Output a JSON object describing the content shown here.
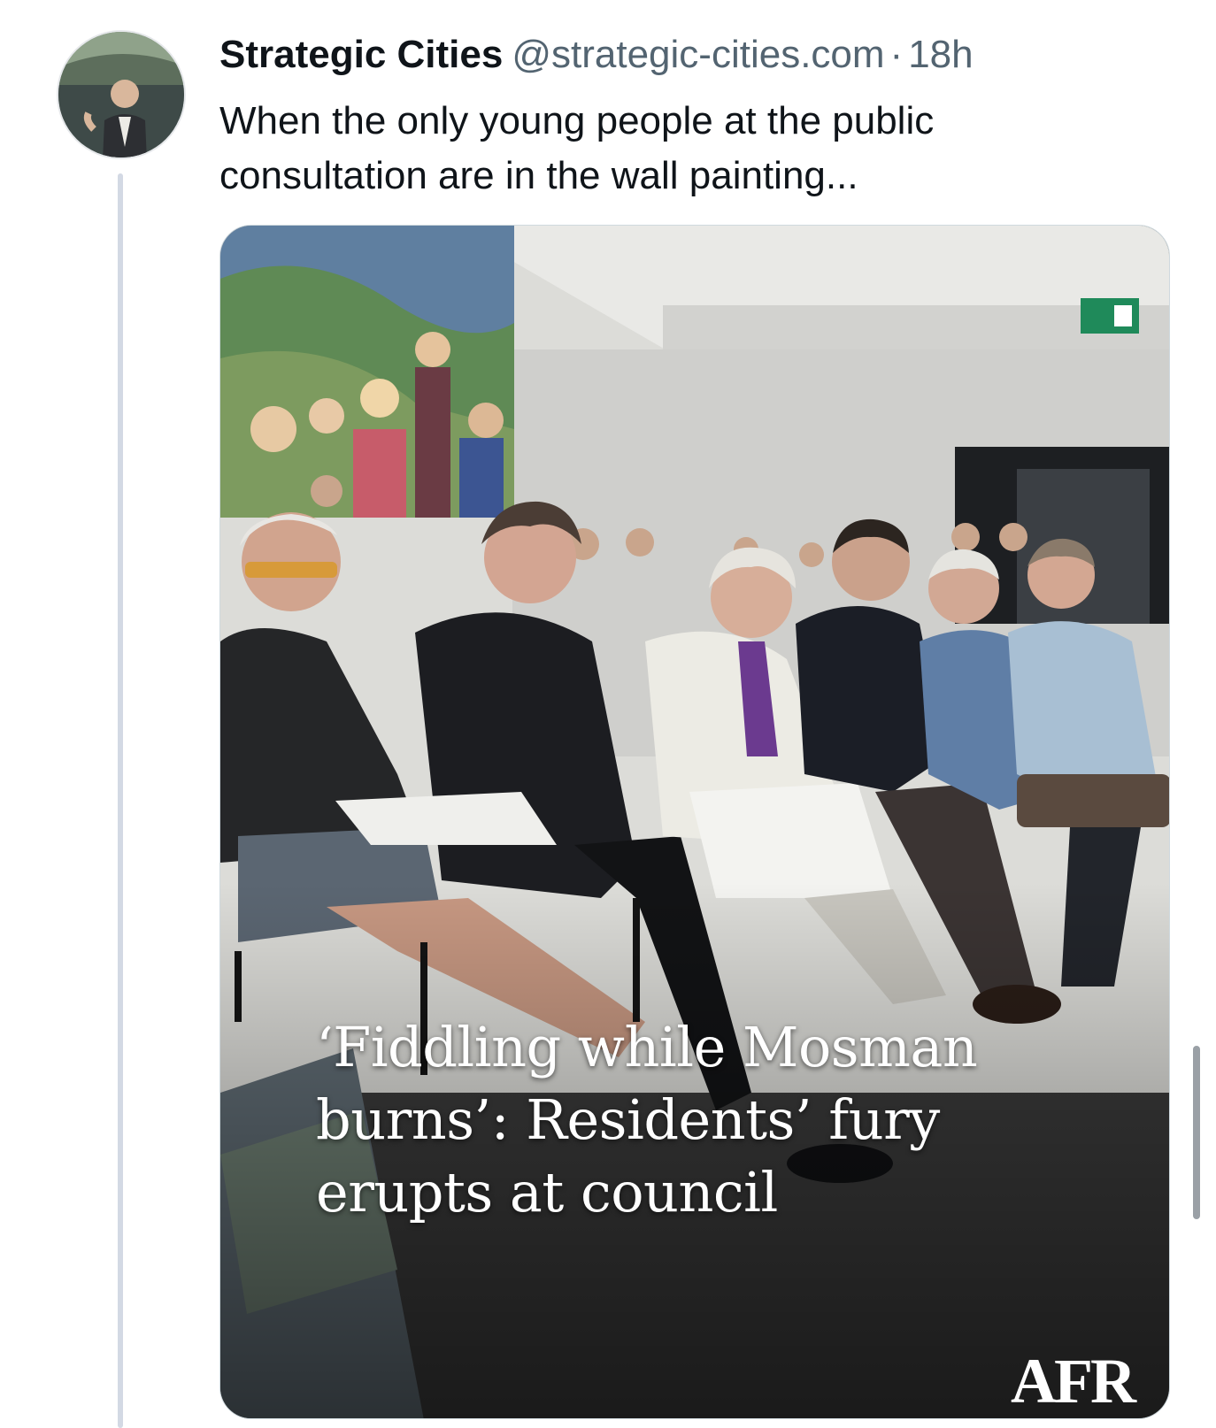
{
  "post": {
    "author_name": "Strategic Cities",
    "author_handle": "@strategic-cities.com",
    "separator": "·",
    "timestamp": "18h",
    "text": "When the only young people at the public consultation are in the wall painting...",
    "avatar_icon": "user-avatar-photo"
  },
  "media": {
    "headline": "‘Fiddling while Mosman burns’: Residents’ fury erupts at council",
    "publisher_logo": "AFR",
    "exit_sign_icon": "exit-sign-icon"
  },
  "colors": {
    "text_primary": "#0f1419",
    "text_secondary": "#536471",
    "thread_line": "#d3d9e4"
  }
}
